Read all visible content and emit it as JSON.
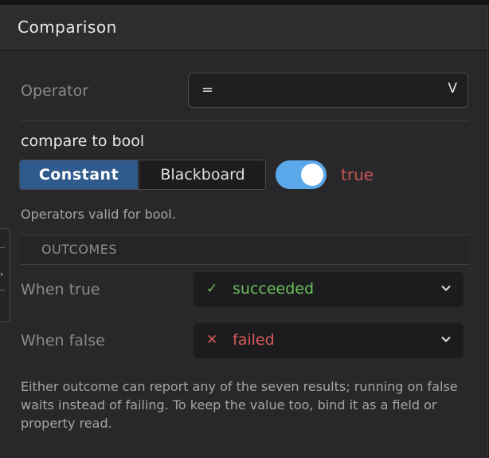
{
  "panel": {
    "title": "Comparison"
  },
  "operator": {
    "label": "Operator",
    "value": "=",
    "chevron": "V"
  },
  "compare": {
    "label": "compare to bool",
    "modes": [
      "Constant",
      "Blackboard"
    ],
    "selected_mode": "Constant",
    "toggle_on": true,
    "value_text": "true",
    "hint": "Operators valid for bool."
  },
  "outcomes": {
    "header": "OUTCOMES",
    "when_true": {
      "label": "When true",
      "icon": "check-icon",
      "value": "succeeded",
      "color": "#6bbf5a"
    },
    "when_false": {
      "label": "When false",
      "icon": "x-icon",
      "value": "failed",
      "color": "#d95a5a"
    }
  },
  "footer": "Either outcome can report any of the seven results; running on false waits instead of failing. To keep the value too, bind it as a field or property read.",
  "colors": {
    "accent": "#2f5a8c",
    "toggle": "#5aa8ea",
    "true_text": "#c65454"
  }
}
